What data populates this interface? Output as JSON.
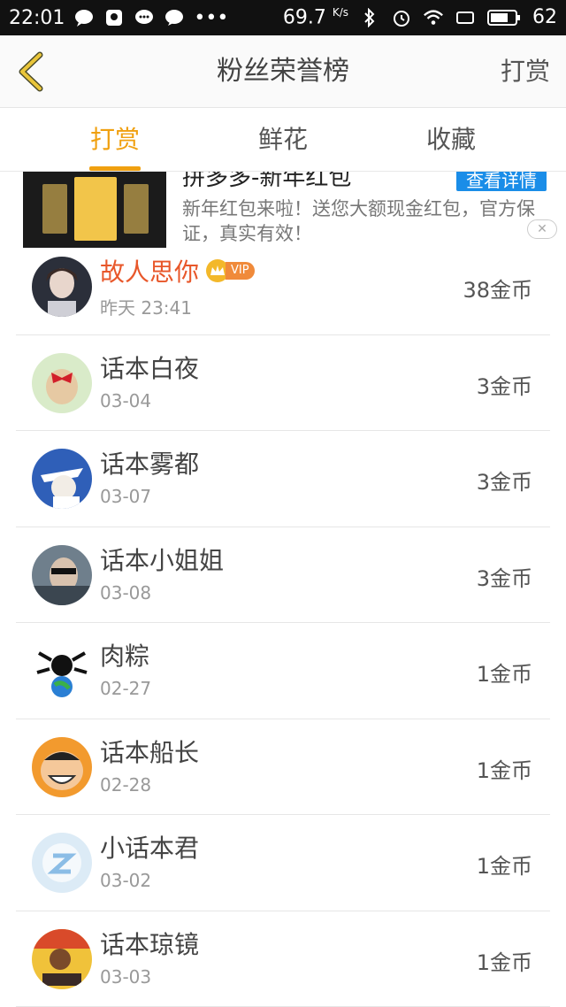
{
  "status_bar": {
    "time": "22:01",
    "speed": "69.7",
    "speed_unit": "K/s",
    "battery": "62"
  },
  "navbar": {
    "title": "粉丝荣誉榜",
    "action_label": "打赏"
  },
  "tabs": [
    {
      "label": "打赏",
      "active": true
    },
    {
      "label": "鲜花",
      "active": false
    },
    {
      "label": "收藏",
      "active": false
    }
  ],
  "ad": {
    "title": "拼多多-新年红包",
    "button_label": "查看详情",
    "description": "新年红包来啦！送您大额现金红包，官方保证，真实有效！"
  },
  "rankings": [
    {
      "name": "故人思你",
      "date": "昨天 23:41",
      "coins": "38金币",
      "vip": true,
      "vip_label": "VIP",
      "avatar": "portrait-girl"
    },
    {
      "name": "话本白夜",
      "date": "03-04",
      "coins": "3金币",
      "vip": false,
      "avatar": "hair-bow"
    },
    {
      "name": "话本雾都",
      "date": "03-07",
      "coins": "3金币",
      "vip": false,
      "avatar": "anime-white-hat"
    },
    {
      "name": "话本小姐姐",
      "date": "03-08",
      "coins": "3金币",
      "vip": false,
      "avatar": "sunglasses-man"
    },
    {
      "name": "肉粽",
      "date": "02-27",
      "coins": "1金币",
      "vip": false,
      "avatar": "skull-globe"
    },
    {
      "name": "话本船长",
      "date": "02-28",
      "coins": "1金币",
      "vip": false,
      "avatar": "laughing-anime"
    },
    {
      "name": "小话本君",
      "date": "03-02",
      "coins": "1金币",
      "vip": false,
      "avatar": "default-z"
    },
    {
      "name": "话本琼镜",
      "date": "03-03",
      "coins": "1金币",
      "vip": false,
      "avatar": "colorful-cartoon"
    }
  ],
  "colors": {
    "accent": "#f0a010",
    "vip_name": "#e8572a",
    "ad_button": "#1a8de8"
  }
}
